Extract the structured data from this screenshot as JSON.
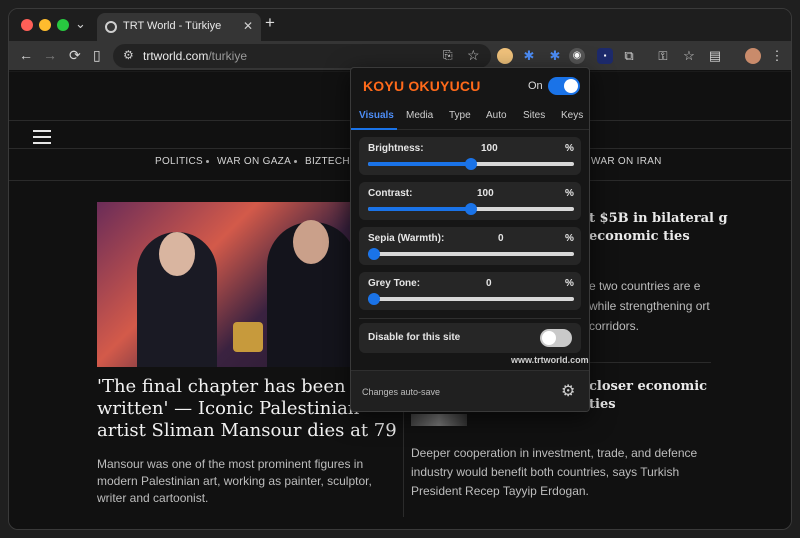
{
  "tab": {
    "title": "TRT World - Türkiye",
    "close": "✕",
    "new": "+"
  },
  "toolbar": {
    "back": "←",
    "forward": "→",
    "reload": "⟳",
    "sidebar": "▯",
    "url_domain": "trtworld.com",
    "url_path": "/turkiye",
    "translate": "⎘",
    "bookmark": "☆"
  },
  "page": {
    "nav": [
      "POLITICS",
      "WAR ON GAZA",
      "BIZTECH",
      "WAR ON IRAN"
    ],
    "main_headline": "'The final chapter has been written' — Iconic Palestinian artist Sliman Mansour dies at 79",
    "main_summary": "Mansour was one of the most prominent figures in modern Palestinian art, working as painter, sculptor, writer and cartoonist.",
    "right_headline_1": "t $5B in bilateral g economic ties",
    "right_text_1": "e two countries are e while strengthening ort corridors.",
    "right_headline_2": "closer economic ties",
    "right_summary_2": "Deeper cooperation in investment, trade, and defence industry would benefit both countries, says Turkish President Recep Tayyip Erdogan."
  },
  "popup": {
    "title": "KOYU OKUYUCU",
    "on_label": "On",
    "enabled": true,
    "tabs": [
      "Visuals",
      "Media",
      "Type",
      "Auto",
      "Sites",
      "Keys"
    ],
    "active_tab": "Visuals",
    "sliders": [
      {
        "label": "Brightness:",
        "value": "100",
        "unit": "%",
        "fraction": 0.5
      },
      {
        "label": "Contrast:",
        "value": "100",
        "unit": "%",
        "fraction": 0.5
      },
      {
        "label": "Sepia (Warmth):",
        "value": "0",
        "unit": "%",
        "fraction": 0.0
      },
      {
        "label": "Grey Tone:",
        "value": "0",
        "unit": "%",
        "fraction": 0.0
      }
    ],
    "disable_label": "Disable for this site",
    "disable_enabled": false,
    "site": "www.trtworld.com",
    "footer": "Changes auto-save"
  },
  "colors": {
    "accent": "#1a73e8",
    "brand": "#ff6a1a"
  }
}
